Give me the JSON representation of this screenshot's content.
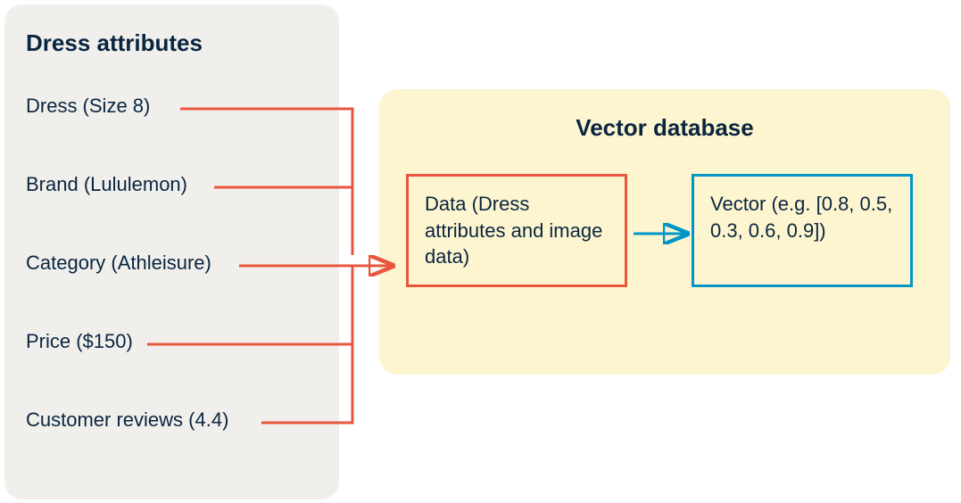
{
  "attributes": {
    "title": "Dress attributes",
    "items": [
      "Dress (Size 8)",
      "Brand (Lululemon)",
      "Category (Athleisure)",
      "Price ($150)",
      "Customer reviews (4.4)"
    ]
  },
  "vectorDatabase": {
    "title": "Vector database",
    "dataBox": "Data (Dress attributes and image data)",
    "vectorBox": "Vector (e.g. [0.8, 0.5, 0.3, 0.6, 0.9])"
  },
  "colors": {
    "attrPanelBg": "#f0efec",
    "dbPanelBg": "#fdf5cf",
    "textDark": "#0a2540",
    "orange": "#e8563f",
    "blue": "#0096c7"
  }
}
